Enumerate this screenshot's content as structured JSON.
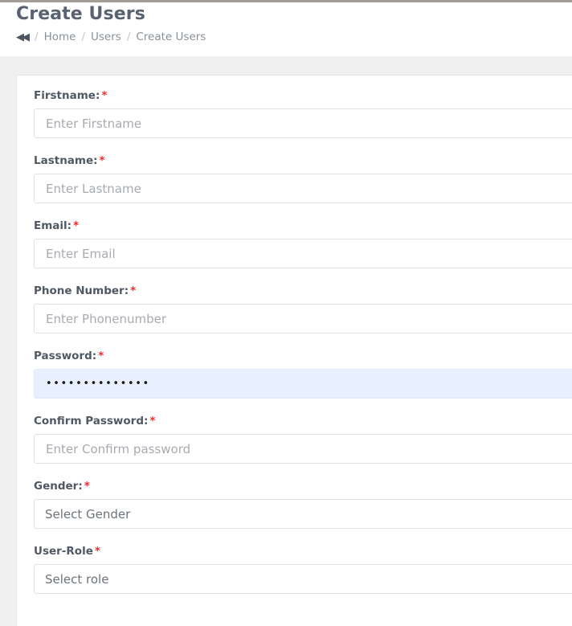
{
  "header": {
    "title": "Create Users",
    "breadcrumb": {
      "back_icon": "◀◀",
      "separator": "/",
      "items": [
        {
          "label": "Home"
        },
        {
          "label": "Users"
        },
        {
          "label": "Create Users"
        }
      ]
    }
  },
  "form": {
    "fields": [
      {
        "label": "Firstname:",
        "required_mark": "*",
        "placeholder": "Enter Firstname",
        "value": "",
        "type": "text"
      },
      {
        "label": "Lastname:",
        "required_mark": "*",
        "placeholder": "Enter Lastname",
        "value": "",
        "type": "text"
      },
      {
        "label": "Email:",
        "required_mark": "*",
        "placeholder": "Enter Email",
        "value": "",
        "type": "text"
      },
      {
        "label": "Phone Number:",
        "required_mark": "*",
        "placeholder": "Enter Phonenumber",
        "value": "",
        "type": "text"
      },
      {
        "label": "Password:",
        "required_mark": "*",
        "placeholder": "",
        "value": "••••••••••••••",
        "type": "password"
      },
      {
        "label": "Confirm Password:",
        "required_mark": "*",
        "placeholder": "Enter Confirm password",
        "value": "",
        "type": "text"
      },
      {
        "label": "Gender:",
        "required_mark": "*",
        "placeholder": "Select Gender",
        "value": "Select Gender",
        "type": "select"
      },
      {
        "label": "User-Role",
        "required_mark": "*",
        "placeholder": "Select role",
        "value": "Select role",
        "type": "select"
      }
    ]
  },
  "colors": {
    "accent_required": "#ef2c2c",
    "title": "#59626e",
    "autofill_background": "#e8f0fe",
    "page_background": "#f0f0f0",
    "top_rule": "#a39e93"
  }
}
